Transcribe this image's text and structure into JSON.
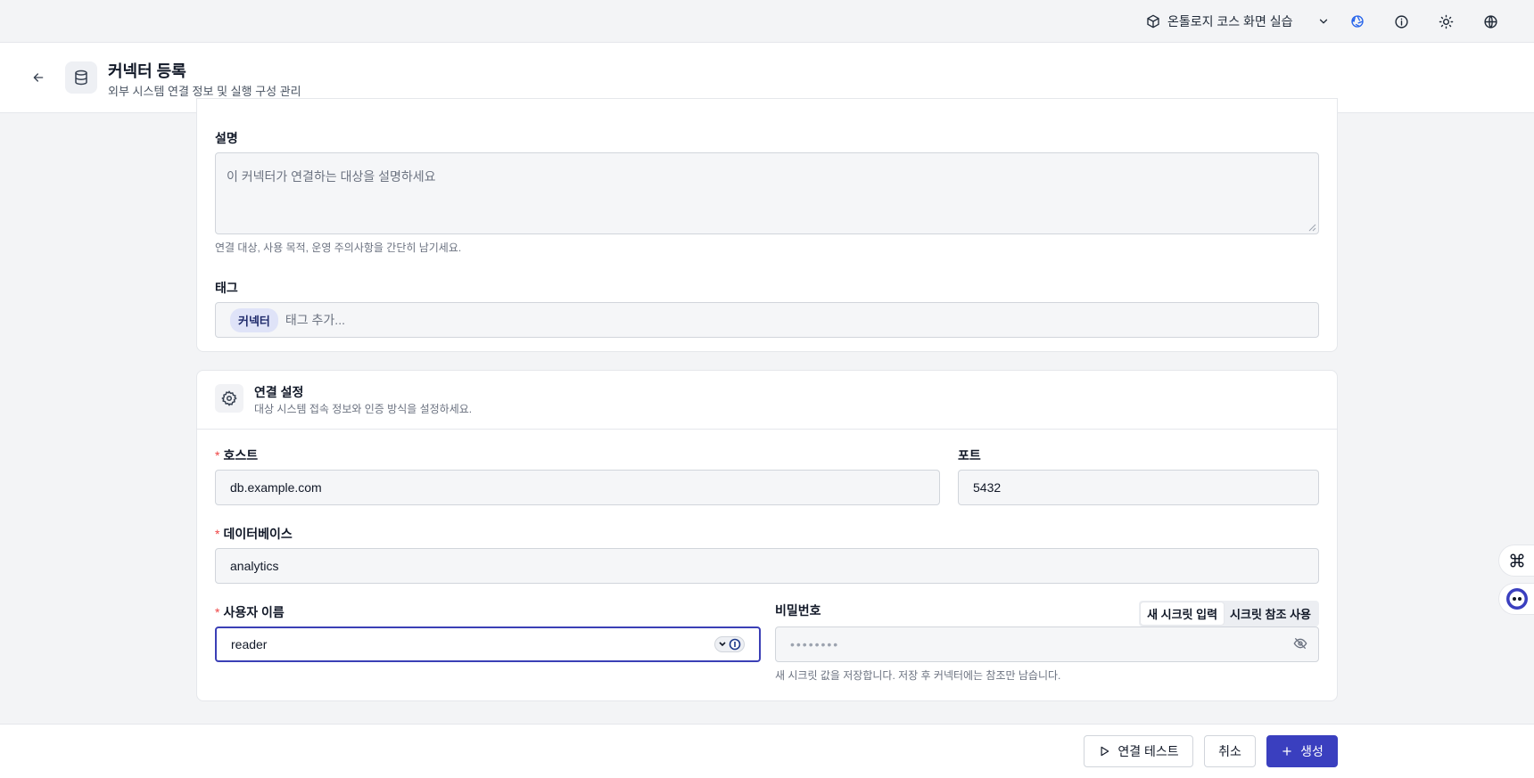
{
  "topbar": {
    "project_name": "온톨로지 코스 화면 실습",
    "icons": [
      "cube-icon",
      "chevron-down-icon",
      "aperture-icon",
      "info-icon",
      "sun-icon",
      "globe-icon"
    ]
  },
  "header": {
    "title": "커넥터 등록",
    "subtitle": "외부 시스템 연결 정보 및 실행 구성 관리"
  },
  "general": {
    "description_label": "설명",
    "description_placeholder": "이 커넥터가 연결하는 대상을 설명하세요",
    "description_help": "연결 대상, 사용 목적, 운영 주의사항을 간단히 남기세요.",
    "tags_label": "태그",
    "tags": [
      "커넥터"
    ],
    "tags_placeholder": "태그 추가..."
  },
  "connection": {
    "title": "연결 설정",
    "subtitle": "대상 시스템 접속 정보와 인증 방식을 설정하세요.",
    "host_label": "호스트",
    "host_value": "db.example.com",
    "port_label": "포트",
    "port_value": "5432",
    "database_label": "데이터베이스",
    "database_value": "analytics",
    "username_label": "사용자 이름",
    "username_value": "reader",
    "password_label": "비밀번호",
    "password_placeholder": "••••••••",
    "secret_mode_new": "새 시크릿 입력",
    "secret_mode_ref": "시크릿 참조 사용",
    "password_help": "새 시크릿 값을 저장합니다. 저장 후 커넥터에는 참조만 남습니다."
  },
  "footer": {
    "test_label": "연결 테스트",
    "cancel_label": "취소",
    "create_label": "생성"
  },
  "colors": {
    "primary": "#3a3fbf",
    "required": "#ef4444",
    "focus_border": "#3b3fb6"
  }
}
